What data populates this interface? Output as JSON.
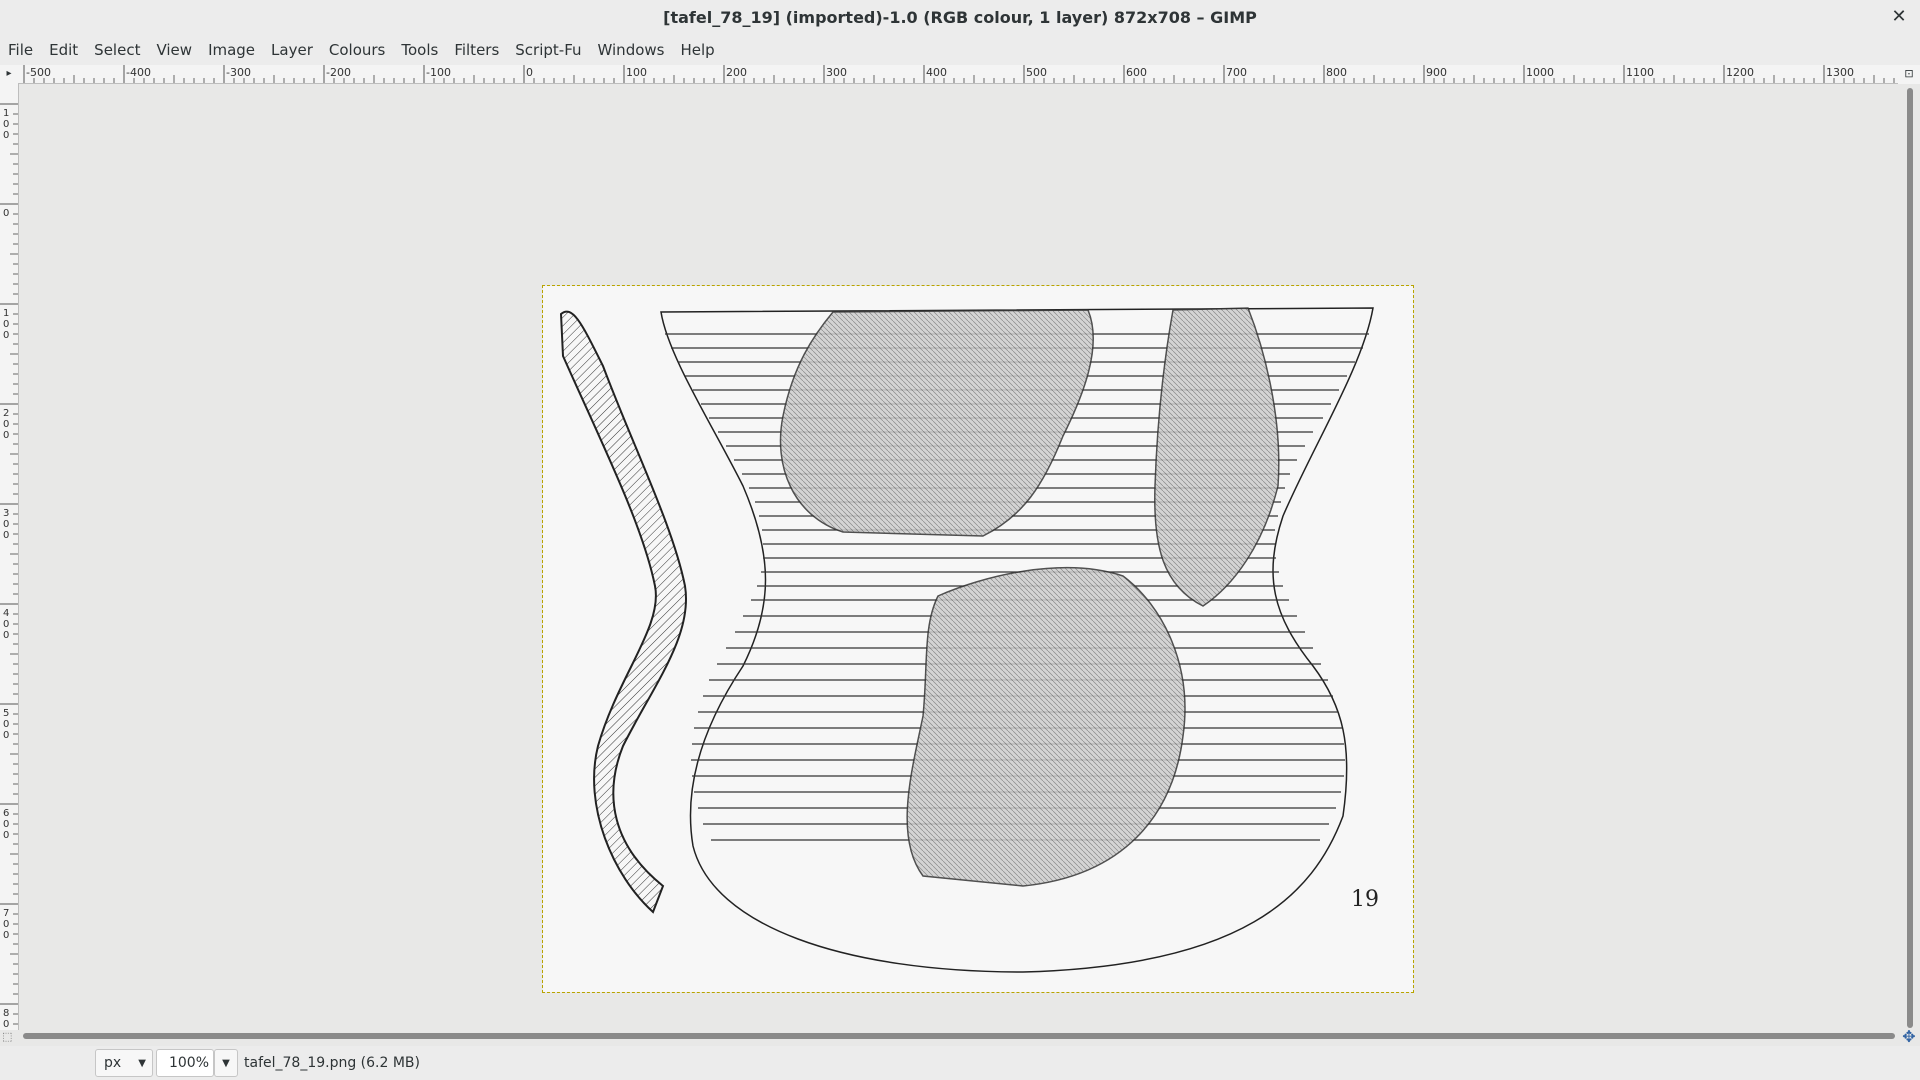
{
  "window": {
    "title": "[tafel_78_19] (imported)-1.0 (RGB colour, 1 layer) 872x708 – GIMP",
    "close_glyph": "✕"
  },
  "menu": [
    "File",
    "Edit",
    "Select",
    "View",
    "Image",
    "Layer",
    "Colours",
    "Tools",
    "Filters",
    "Script-Fu",
    "Windows",
    "Help"
  ],
  "ruler": {
    "h_labels": [
      "-500",
      "-400",
      "-300",
      "-200",
      "-100",
      "0",
      "100",
      "200",
      "300",
      "400",
      "500",
      "600",
      "700",
      "800",
      "900",
      "1000",
      "1100",
      "1200",
      "1300"
    ],
    "v_labels": [
      "100",
      "0",
      "100",
      "200",
      "300",
      "400",
      "500",
      "600",
      "700",
      "800"
    ]
  },
  "image": {
    "annotation": "19"
  },
  "status": {
    "unit": "px",
    "zoom": "100%",
    "file_info": "tafel_78_19.png (6.2 MB)"
  },
  "icons": {
    "close": "close-icon",
    "dropdown": "chevron-down-icon",
    "navigate": "navigate-icon"
  }
}
